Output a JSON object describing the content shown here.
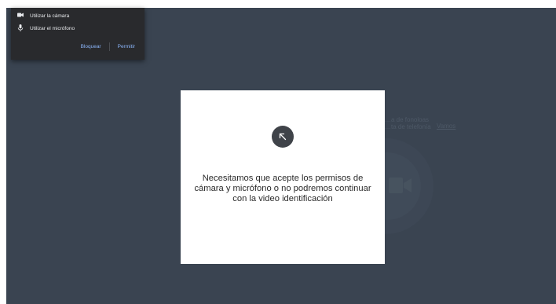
{
  "permission_popup": {
    "camera_label": "Utilizar la cámara",
    "mic_label": "Utilizar el micrófono",
    "block_label": "Bloquear",
    "allow_label": "Permitir",
    "camera_icon": "camera-icon",
    "mic_icon": "microphone-icon"
  },
  "background": {
    "hint_line1": "…a de fonoloas",
    "hint_line2": "…ta de telefonía",
    "hint_link": "Vamos",
    "camera_icon": "video-camera-icon"
  },
  "modal": {
    "icon": "arrow-up-left-icon",
    "message": "Necesitamos que acepte los permisos de cámara y micrófono o no podremos continuar con la video identificación"
  },
  "colors": {
    "app_background": "#3a4451",
    "popup_background": "#292a2d",
    "popup_link": "#8ab4f8",
    "modal_background": "#ffffff",
    "arrow_circle": "#3f4349"
  }
}
